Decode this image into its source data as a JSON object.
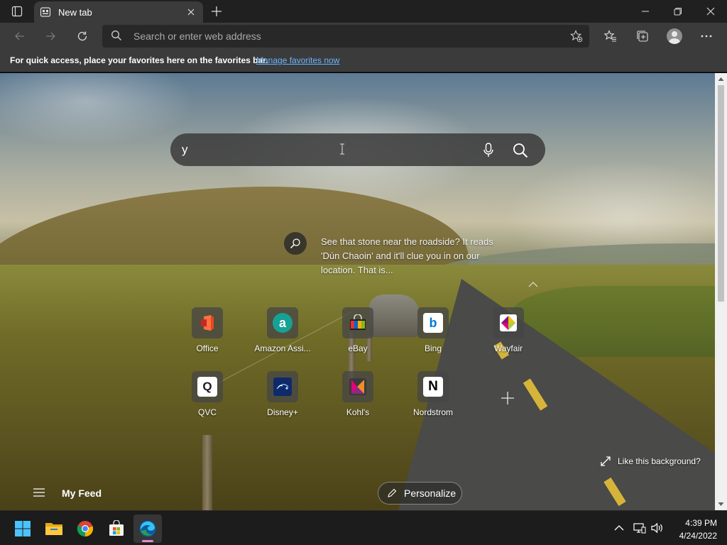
{
  "browser": {
    "tab": {
      "title": "New tab"
    },
    "address_bar": {
      "placeholder": "Search or enter web address"
    },
    "favorites_bar": {
      "message": "For quick access, place your favorites here on the favorites bar.",
      "link": "Manage favorites now"
    }
  },
  "newtab": {
    "search": {
      "value": "y"
    },
    "image_info": {
      "text": "See that stone near the roadside? It reads 'Dún Chaoin' and it'll clue you in on our location. That is..."
    },
    "quick_links": [
      {
        "label": "Office",
        "icon": "office-icon",
        "color": "#d83b01"
      },
      {
        "label": "Amazon Assi...",
        "icon": "amazon-assistant-icon",
        "color": "#16a195"
      },
      {
        "label": "eBay",
        "icon": "ebay-icon",
        "color": "#e53238"
      },
      {
        "label": "Bing",
        "icon": "bing-icon",
        "color": "#0078d4"
      },
      {
        "label": "Wayfair",
        "icon": "wayfair-icon",
        "color": "#7f187f"
      },
      {
        "label": "QVC",
        "icon": "qvc-icon",
        "color": "#1b1b1b"
      },
      {
        "label": "Disney+",
        "icon": "disney-plus-icon",
        "color": "#1a3b8f"
      },
      {
        "label": "Kohl's",
        "icon": "kohls-icon",
        "color": "#e6007e"
      },
      {
        "label": "Nordstrom",
        "icon": "nordstrom-icon",
        "color": "#000000"
      }
    ],
    "like_background": "Like this background?",
    "feed_label": "My Feed",
    "personalize_label": "Personalize"
  },
  "taskbar": {
    "apps": [
      "start-icon",
      "file-explorer-icon",
      "chrome-icon",
      "microsoft-store-icon",
      "edge-icon"
    ],
    "time": "4:39 PM",
    "date": "4/24/2022"
  },
  "colors": {
    "accent_link": "#6cb4ff",
    "taskbar_active_indicator": "#e38bd0"
  }
}
